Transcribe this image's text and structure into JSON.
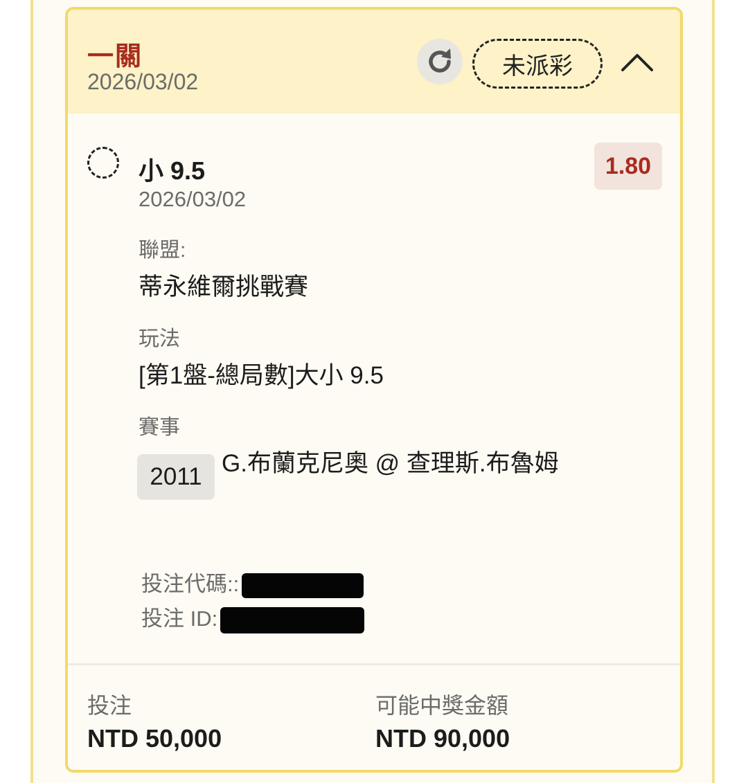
{
  "header": {
    "title": "一關",
    "date": "2026/03/02",
    "status_label": "未派彩",
    "refresh_icon": "refresh-icon",
    "collapse_icon": "chevron-up-icon"
  },
  "selection": {
    "pick": "小 9.5",
    "date": "2026/03/02",
    "odds": "1.80",
    "league_label": "聯盟:",
    "league_value": "蒂永維爾挑戰賽",
    "market_label": "玩法",
    "market_value": "[第1盤-總局數]大小 9.5",
    "event_label": "賽事",
    "event_id": "2011",
    "event_name": "G.布蘭克尼奧 @ 查理斯.布魯姆",
    "bet_code_label": "投注代碼::",
    "bet_id_label": "投注 ID:"
  },
  "footer": {
    "stake_label": "投注",
    "stake_value": "NTD 50,000",
    "payout_label": "可能中獎金額",
    "payout_value": "NTD 90,000"
  },
  "colors": {
    "accent_red": "#a72d1f",
    "header_bg": "#fdf2c8",
    "card_border": "#f2d96a",
    "odds_bg": "#f3e3dd"
  }
}
